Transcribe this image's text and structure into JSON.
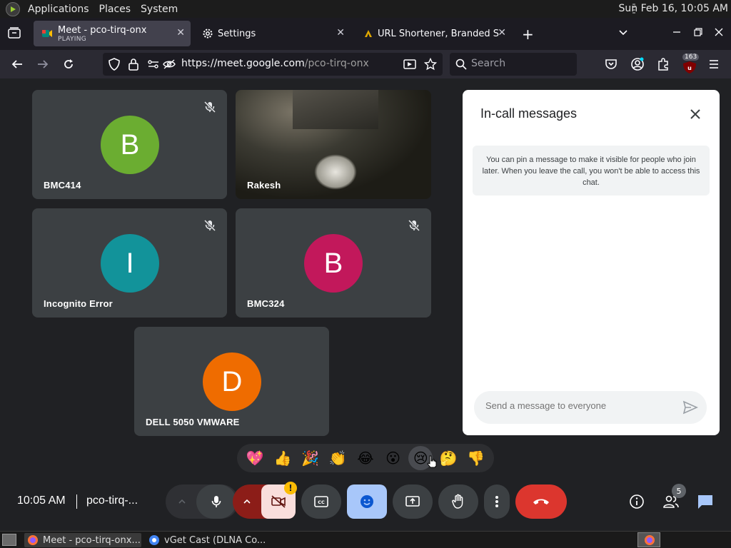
{
  "panel": {
    "menus": [
      "Applications",
      "Places",
      "System"
    ],
    "clock": "Sun Feb 16, 10:05 AM"
  },
  "tabs": [
    {
      "title": "Meet - pco-tirq-onx",
      "subtitle": "PLAYING"
    },
    {
      "title": "Settings",
      "subtitle": ""
    },
    {
      "title": "URL Shortener, Branded Sh",
      "subtitle": ""
    }
  ],
  "urlbar": {
    "host": "https://meet.google.com",
    "path": "/pco-tirq-onx"
  },
  "searchbar": {
    "placeholder": "Search"
  },
  "extensions": {
    "badge": "163"
  },
  "participants": [
    {
      "name": "BMC414",
      "initial": "B",
      "color": "#6bad31",
      "muted": true,
      "video": false
    },
    {
      "name": "Rakesh",
      "initial": "",
      "color": "",
      "muted": false,
      "video": true
    },
    {
      "name": "Incognito Error",
      "initial": "I",
      "color": "#12939a",
      "muted": true,
      "video": false
    },
    {
      "name": "BMC324",
      "initial": "B",
      "color": "#c2185b",
      "muted": true,
      "video": false
    },
    {
      "name": "DELL 5050 VMWARE",
      "initial": "D",
      "color": "#ef6c00",
      "muted": false,
      "video": false
    }
  ],
  "chat": {
    "title": "In-call messages",
    "info": "You can pin a message to make it visible for people who join later. When you leave the call, you won't be able to access this chat.",
    "input_placeholder": "Send a message to everyone"
  },
  "reactions": [
    "💖",
    "👍",
    "🎉",
    "👏",
    "😂",
    "😮",
    "😢",
    "🤔",
    "👎"
  ],
  "meeting": {
    "time": "10:05 AM",
    "code": "pco-tirq-..."
  },
  "people_count": "5",
  "camera_warning": "!",
  "colors": {
    "leave_red": "#ea4335",
    "active_blue": "#a8c7fa",
    "camera_off": "#f9dedc"
  },
  "taskbar": {
    "items": [
      "Meet - pco-tirq-onx...",
      "vGet Cast (DLNA Co..."
    ]
  }
}
